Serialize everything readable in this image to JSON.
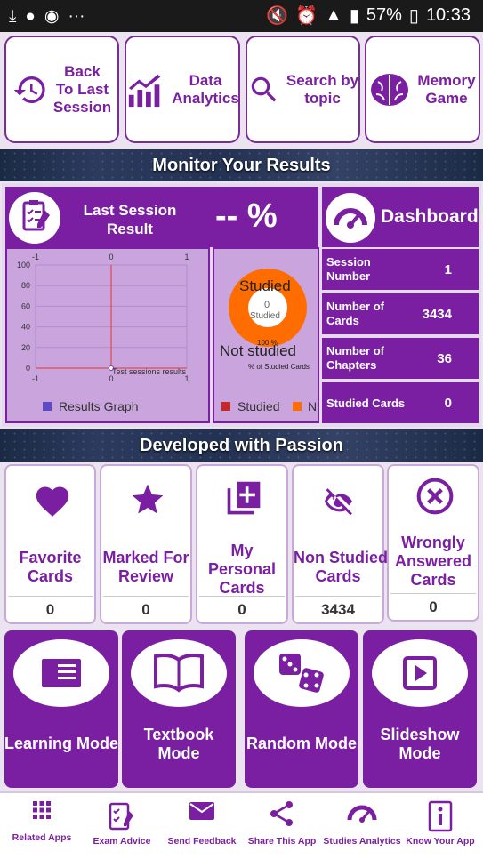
{
  "status": {
    "battery": "57%",
    "time": "10:33"
  },
  "nav": [
    {
      "label": "Back\nTo Last\nSession",
      "icon": "history-icon"
    },
    {
      "label": "Data\nAnalytics",
      "icon": "analytics-icon"
    },
    {
      "label": "Search by\ntopic",
      "icon": "search-icon"
    },
    {
      "label": "Memory\nGame",
      "icon": "brain-icon"
    }
  ],
  "banners": {
    "monitor": "Monitor Your Results",
    "passion": "Developed with Passion"
  },
  "last_session": {
    "title": "Last Session\nResult",
    "value": "-- %"
  },
  "results_graph": {
    "legend": "Results Graph",
    "annotation": "Test sessions results",
    "top_ticks": [
      "-1",
      "0",
      "1"
    ],
    "bottom_ticks": [
      "-1",
      "0",
      "1"
    ],
    "y_ticks": [
      "100",
      "80",
      "60",
      "40",
      "20",
      "0"
    ]
  },
  "chart_data": [
    {
      "type": "scatter",
      "series": [
        {
          "name": "Results Graph",
          "points": [
            [
              0,
              0
            ]
          ]
        }
      ],
      "xlim": [
        -1,
        1
      ],
      "ylim": [
        0,
        100
      ],
      "annotation": "Test sessions results"
    },
    {
      "type": "pie",
      "labels": [
        "Studied",
        "Not studied"
      ],
      "values": [
        0,
        100
      ],
      "center_value": "0",
      "center_label": "Studied",
      "caption": "% of Studied Cards",
      "percent_label": "100 %",
      "colors": [
        "#c62828",
        "#ff6d00"
      ]
    }
  ],
  "pie": {
    "studied_label": "Studied",
    "not_studied_label": "Not studied",
    "center_value": "0",
    "center_label": "Studied",
    "percent": "100 %",
    "caption": "% of Studied Cards",
    "legend_studied": "Studied",
    "legend_not": "N"
  },
  "dashboard": {
    "title": "Dashboard",
    "rows": [
      {
        "label": "Session\nNumber",
        "value": "1"
      },
      {
        "label": "Number of\nCards",
        "value": "3434"
      },
      {
        "label": "Number of\nChapters",
        "value": "36"
      },
      {
        "label": "Studied Cards",
        "value": "0"
      }
    ]
  },
  "cards": [
    {
      "label": "Favorite\nCards",
      "count": "0",
      "icon": "heart-icon"
    },
    {
      "label": "Marked For\nReview",
      "count": "0",
      "icon": "star-icon"
    },
    {
      "label": "My\nPersonal\nCards",
      "count": "0",
      "icon": "add-card-icon"
    },
    {
      "label": "Non Studied\nCards",
      "count": "3434",
      "icon": "eye-off-icon"
    },
    {
      "label": "Wrongly\nAnswered\nCards",
      "count": "0",
      "icon": "x-circle-icon"
    }
  ],
  "modes": [
    {
      "label": "Learning Mode",
      "icon": "book-icon"
    },
    {
      "label": "Textbook\nMode",
      "icon": "open-book-icon"
    },
    {
      "label": "Random Mode",
      "icon": "dice-icon"
    },
    {
      "label": "Slideshow\nMode",
      "icon": "play-icon"
    }
  ],
  "bottom_bar": [
    {
      "label": "Related Apps",
      "icon": "grid-icon"
    },
    {
      "label": "Exam Advice",
      "icon": "checklist-icon"
    },
    {
      "label": "Send Feedback",
      "icon": "mail-icon"
    },
    {
      "label": "Share This App",
      "icon": "share-icon"
    },
    {
      "label": "Studies Analytics",
      "icon": "gauge-icon"
    },
    {
      "label": "Know Your App",
      "icon": "info-icon"
    }
  ]
}
